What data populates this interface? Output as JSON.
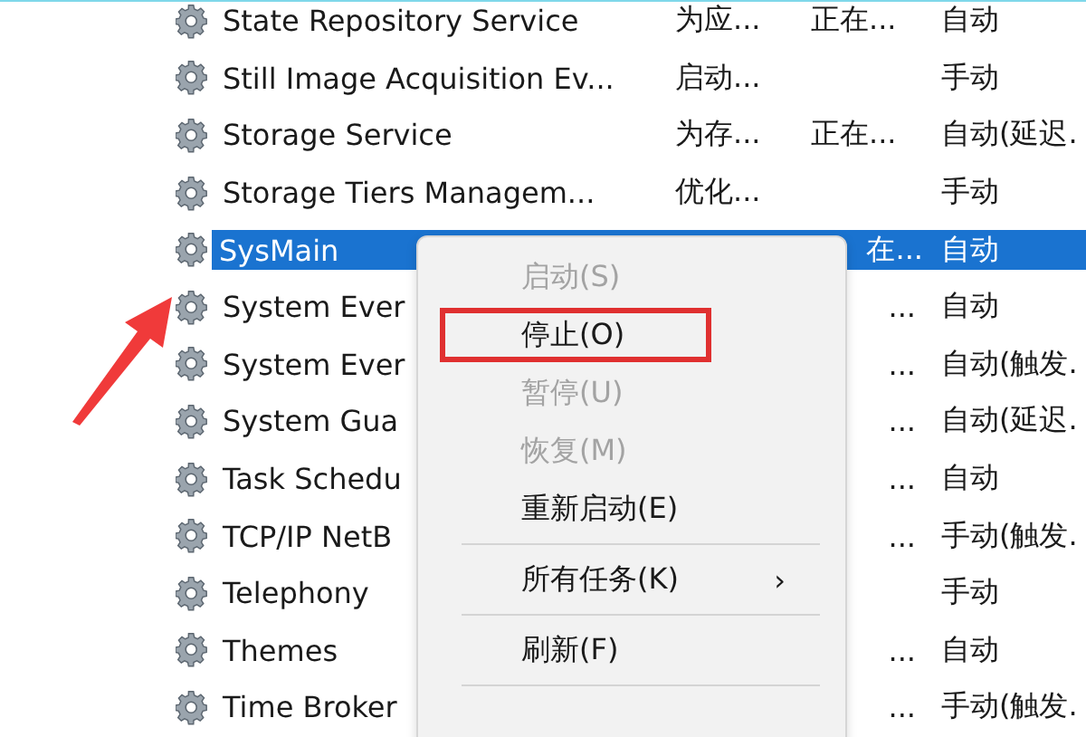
{
  "services": [
    {
      "name": "State Repository Service",
      "description": "为应...",
      "status": "正在...",
      "startup": "自动",
      "selected": false
    },
    {
      "name": "Still Image Acquisition Ev...",
      "description": "启动...",
      "startup": "手动",
      "selected": false
    },
    {
      "name": "Storage Service",
      "description": "为存...",
      "status": "正在...",
      "startup": "自动(延迟.",
      "selected": false
    },
    {
      "name": "Storage Tiers Managem...",
      "description": "优化...",
      "startup": "手动",
      "selected": false
    },
    {
      "name": "SysMain",
      "status": "在...",
      "startup": "自动",
      "selected": true
    },
    {
      "name": "System Ever",
      "status": "...",
      "startup": "自动",
      "selected": false
    },
    {
      "name": "System Ever",
      "status": "...",
      "startup": "自动(触发.",
      "selected": false
    },
    {
      "name": "System Gua",
      "status": "...",
      "startup": "自动(延迟.",
      "selected": false
    },
    {
      "name": "Task Schedu",
      "status": "...",
      "startup": "自动",
      "selected": false
    },
    {
      "name": "TCP/IP NetB",
      "status": "...",
      "startup": "手动(触发.",
      "selected": false
    },
    {
      "name": "Telephony",
      "startup": "手动",
      "selected": false
    },
    {
      "name": "Themes",
      "status": "...",
      "startup": "自动",
      "selected": false
    },
    {
      "name": "Time Broker",
      "status": "...",
      "startup": "手动(触发.",
      "selected": false
    }
  ],
  "context_menu": [
    {
      "kind": "item",
      "label": "启动(S)",
      "disabled": true,
      "highlighted": false
    },
    {
      "kind": "item",
      "label": "停止(O)",
      "disabled": false,
      "highlighted": true
    },
    {
      "kind": "item",
      "label": "暂停(U)",
      "disabled": true,
      "highlighted": false
    },
    {
      "kind": "item",
      "label": "恢复(M)",
      "disabled": true,
      "highlighted": false
    },
    {
      "kind": "item",
      "label": "重新启动(E)",
      "disabled": false,
      "highlighted": false
    },
    {
      "kind": "separator"
    },
    {
      "kind": "submenu",
      "label": "所有任务(K)",
      "disabled": false,
      "highlighted": false,
      "marker": "›"
    },
    {
      "kind": "separator"
    },
    {
      "kind": "item",
      "label": "刷新(F)",
      "disabled": false,
      "highlighted": false
    },
    {
      "kind": "separator"
    }
  ]
}
